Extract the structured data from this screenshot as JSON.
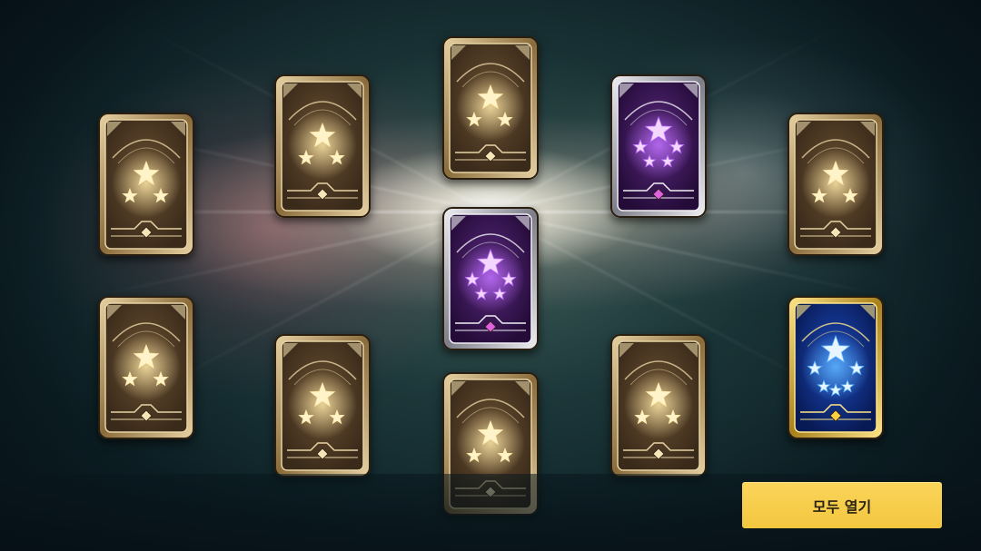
{
  "screen": "card-pack-open",
  "open_all_button": {
    "label": "모두 열기"
  },
  "colors": {
    "accent_button": "#f3c63f",
    "bronze_frame": "#c9a76a",
    "silver_frame": "#c9c9cf",
    "gold_frame": "#e8c256",
    "purple_glow": "#b05cf0",
    "blue_glow": "#4aa0ff"
  },
  "cards": [
    {
      "id": "card-1",
      "rarity": "bronze",
      "icon": "three-star-icon",
      "face_down": true
    },
    {
      "id": "card-2",
      "rarity": "bronze",
      "icon": "three-star-icon",
      "face_down": true
    },
    {
      "id": "card-3",
      "rarity": "bronze",
      "icon": "three-star-icon",
      "face_down": true
    },
    {
      "id": "card-4",
      "rarity": "silver",
      "icon": "five-star-icon",
      "face_down": true
    },
    {
      "id": "card-5",
      "rarity": "bronze",
      "icon": "three-star-icon",
      "face_down": true
    },
    {
      "id": "card-6",
      "rarity": "silver",
      "icon": "five-star-icon",
      "face_down": true
    },
    {
      "id": "card-7",
      "rarity": "bronze",
      "icon": "three-star-icon",
      "face_down": true
    },
    {
      "id": "card-8",
      "rarity": "bronze",
      "icon": "three-star-icon",
      "face_down": true
    },
    {
      "id": "card-9",
      "rarity": "bronze",
      "icon": "three-star-icon",
      "face_down": true
    },
    {
      "id": "card-10",
      "rarity": "bronze",
      "icon": "three-star-icon",
      "face_down": true
    },
    {
      "id": "card-11",
      "rarity": "gold",
      "icon": "six-star-icon",
      "face_down": true
    }
  ]
}
